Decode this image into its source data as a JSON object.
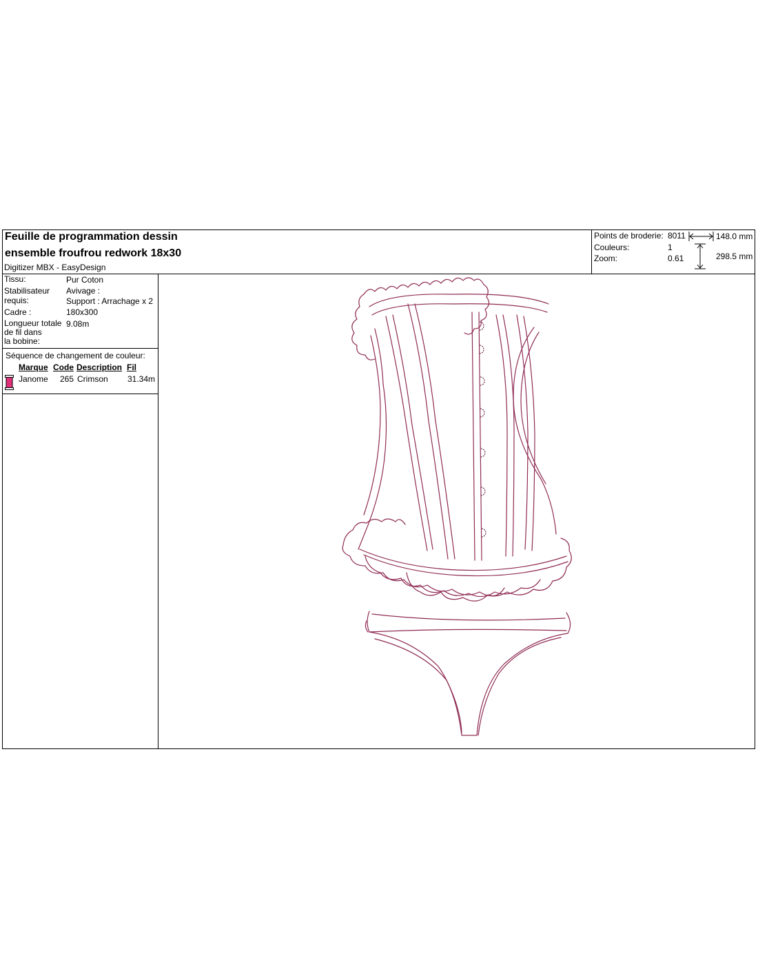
{
  "header": {
    "title_line1": "Feuille de programmation dessin",
    "title_line2": "ensemble froufrou redwork 18x30",
    "software": "Digitizer MBX - EasyDesign"
  },
  "stats": {
    "points_label": "Points de broderie:",
    "points_value": "8011",
    "colors_label": "Couleurs:",
    "colors_value": "1",
    "zoom_label": "Zoom:",
    "zoom_value": "0.61",
    "width": "148.0 mm",
    "height": "298.5 mm"
  },
  "info": {
    "fabric_label": "Tissu:",
    "fabric_value": "Pur Coton",
    "stabilizer_label_1": "Stabilisateur",
    "stabilizer_label_2": "requis:",
    "stabilizer_value_1": "Avivage :",
    "stabilizer_value_2": "Support : Arrachage x 2",
    "frame_label": "Cadre :",
    "frame_value": "180x300",
    "thread_label_1": "Longueur totale",
    "thread_label_2": "de fil dans",
    "thread_label_3": "la bobine:",
    "thread_value": "9.08m"
  },
  "color_sequence": {
    "title": "Séquence de changement de couleur:",
    "columns": [
      "Marque",
      "Code",
      "Description",
      "Fil"
    ],
    "rows": [
      {
        "brand": "Janome",
        "code": "265",
        "description": "Crimson",
        "length": "31.34m",
        "swatch": "#e0307a"
      }
    ]
  },
  "design": {
    "stitch_color": "#8e2a52"
  }
}
